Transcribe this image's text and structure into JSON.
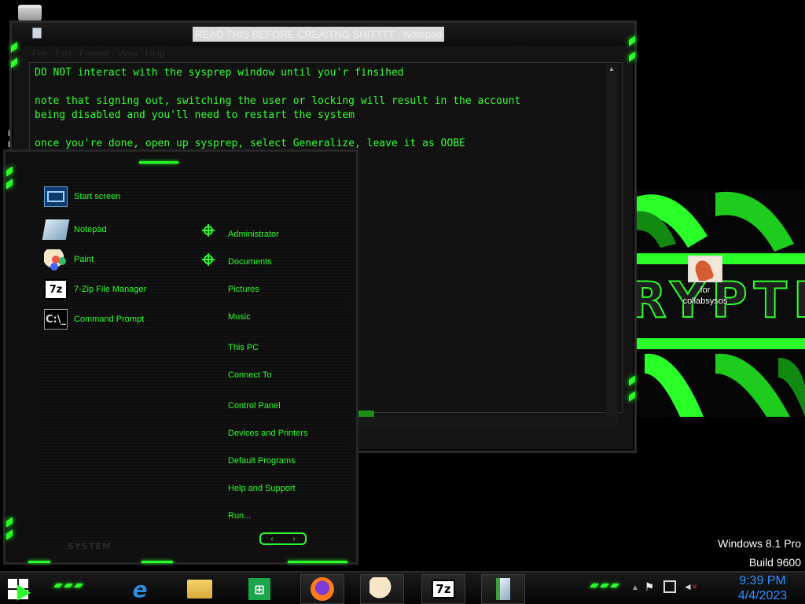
{
  "desktop": {
    "icons": [
      {
        "label": "for collabsysos"
      }
    ],
    "wallpaper_text": "RYPTIC",
    "partial_letters": [
      "R",
      "E"
    ],
    "watermark": {
      "line1": "Windows 8.1 Pro",
      "line2": "Build 9600"
    }
  },
  "notepad": {
    "title": "READ THIS BEFORE CREAITNG SHITTTT - Notepad",
    "menu": [
      "File",
      "Edit",
      "Format",
      "View",
      "Help"
    ],
    "content": "DO NOT interact with the sysprep window until you'r finsihed\n\nnote that signing out, switching the user or locking will result in the account\nbeing disabled and you'll need to restart the system\n\nonce you're done, open up sysprep, select Generalize, leave it as OOBE"
  },
  "start_menu": {
    "apps": [
      {
        "label": "Start screen",
        "icon": "start-screen-icon"
      },
      {
        "label": "Notepad",
        "icon": "notepad-icon"
      },
      {
        "label": "Paint",
        "icon": "paint-icon"
      },
      {
        "label": "7-Zip File Manager",
        "icon": "7zip-icon"
      },
      {
        "label": "Command Prompt",
        "icon": "cmd-icon"
      }
    ],
    "places": [
      "Administrator",
      "Documents",
      "Pictures",
      "Music",
      "This PC",
      "Connect To",
      "Control Panel",
      "Devices and Printers",
      "Default Programs",
      "Help and Support",
      "Run..."
    ],
    "footer_text": "SYSTEM",
    "cmd_glyph": "C:\\_",
    "zip_glyph": "7z"
  },
  "taskbar": {
    "pinned": [
      {
        "name": "internet-explorer",
        "glyph": "e"
      },
      {
        "name": "file-explorer",
        "glyph": ""
      },
      {
        "name": "store",
        "glyph": "⊞"
      },
      {
        "name": "firefox",
        "glyph": ""
      },
      {
        "name": "paint",
        "glyph": ""
      },
      {
        "name": "7zip",
        "glyph": "7z"
      },
      {
        "name": "notepad",
        "glyph": ""
      }
    ],
    "time": "9:39 PM",
    "date": "4/4/2023"
  },
  "colors": {
    "accent_green": "#2aff2a",
    "clock_blue": "#2f8fff",
    "background": "#000000"
  }
}
